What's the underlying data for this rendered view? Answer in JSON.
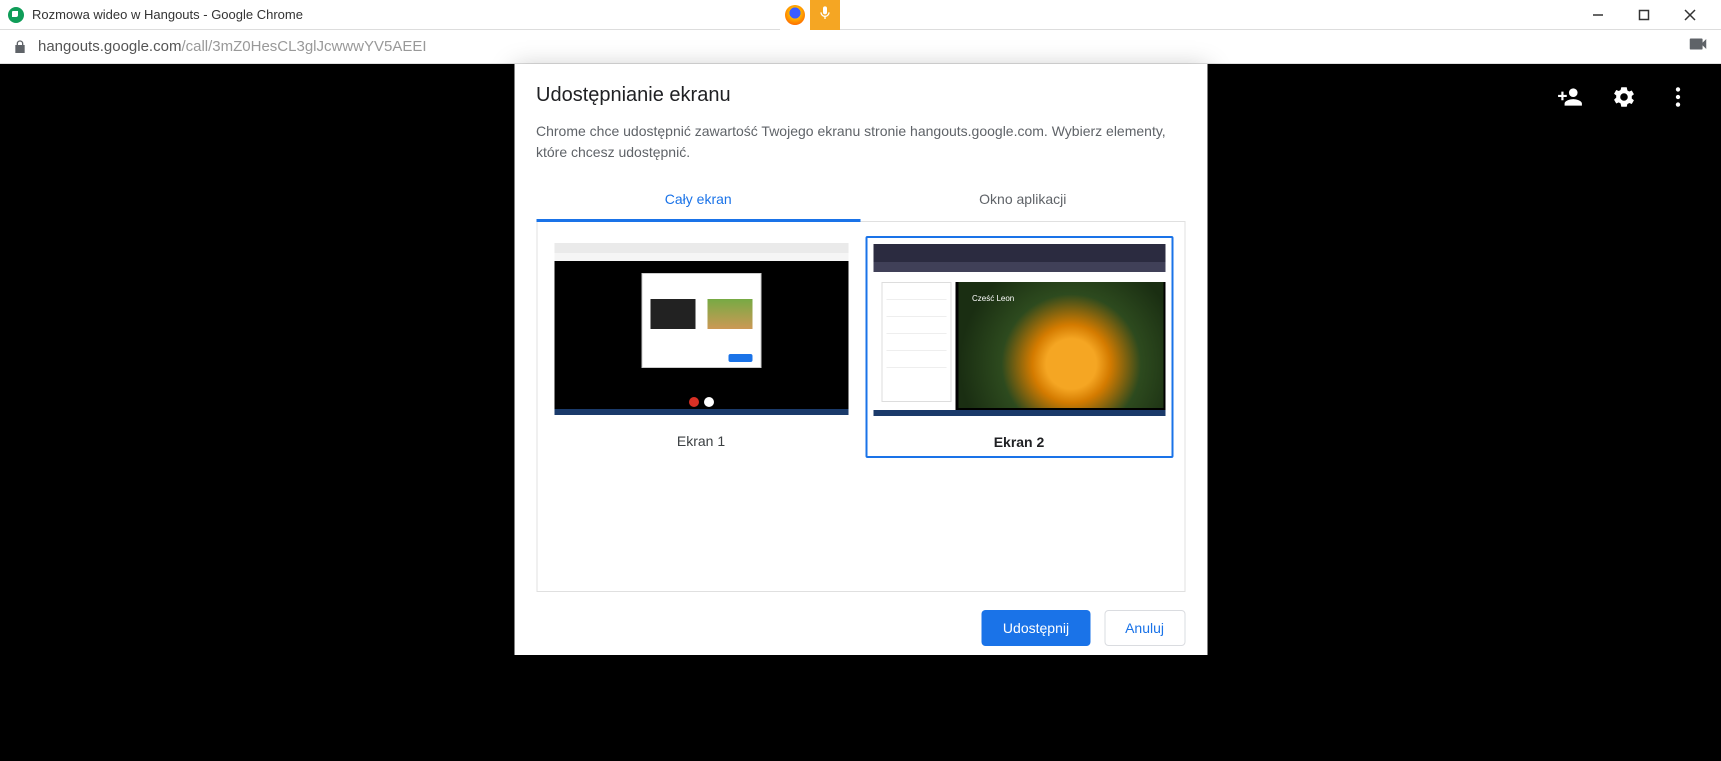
{
  "window": {
    "title": "Rozmowa wideo w Hangouts - Google Chrome"
  },
  "url": {
    "host": "hangouts.google.com",
    "path": "/call/3mZ0HesCL3glJcwwwYV5AEEI"
  },
  "dialog": {
    "title": "Udostępnianie ekranu",
    "description": "Chrome chce udostępnić zawartość Twojego ekranu stronie hangouts.google.com. Wybierz elementy, które chcesz udostępnić.",
    "tabs": {
      "entire_screen": "Cały ekran",
      "app_window": "Okno aplikacji"
    },
    "screens": [
      {
        "label": "Ekran 1",
        "selected": false
      },
      {
        "label": "Ekran 2",
        "selected": true
      }
    ],
    "buttons": {
      "share": "Udostępnij",
      "cancel": "Anuluj"
    }
  },
  "t2_overlay": "Cześć Leon"
}
